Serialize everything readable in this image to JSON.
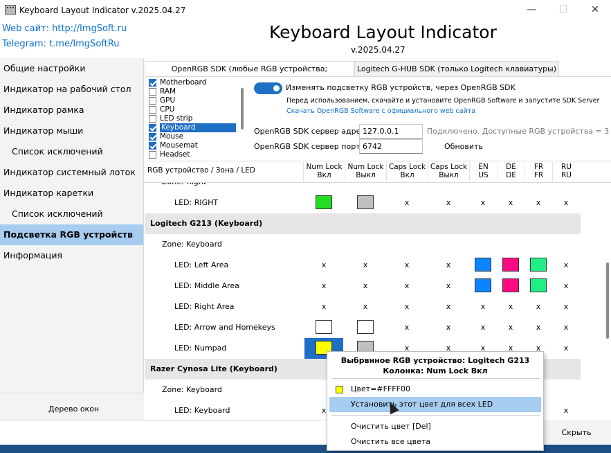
{
  "window": {
    "title": "Keyboard Layout Indicator v.2025.04.27",
    "minimize": "—",
    "maximize": "☐",
    "close": "✕"
  },
  "header": {
    "web_link": "Web сайт: http://ImgSoft.ru",
    "telegram_link": "Telegram: t.me/ImgSoftRu",
    "app_title": "Keyboard Layout Indicator",
    "version": "v.2025.04.27"
  },
  "sidebar": {
    "items": [
      {
        "label": "Общие настройки"
      },
      {
        "label": "Индикатор на рабочий стол"
      },
      {
        "label": "Индикатор рамка"
      },
      {
        "label": "Индикатор мыши"
      },
      {
        "label": "Список исключений"
      },
      {
        "label": "Индикатор системный лоток"
      },
      {
        "label": "Индикатор каретки"
      },
      {
        "label": "Список исключений"
      },
      {
        "label": "Подсветка RGB устройств"
      },
      {
        "label": "Информация"
      }
    ],
    "bottom_label": "Дерево окон"
  },
  "tabs": [
    {
      "label": "OpenRGB SDK (любые RGB устройства; рекомендуется)"
    },
    {
      "label": "Logitech G-HUB SDK (только Logitech клавиатуры)"
    }
  ],
  "devices": [
    {
      "label": "Motherboard",
      "checked": true
    },
    {
      "label": "RAM",
      "checked": false
    },
    {
      "label": "GPU",
      "checked": false
    },
    {
      "label": "CPU",
      "checked": false
    },
    {
      "label": "LED strip",
      "checked": false
    },
    {
      "label": "Keyboard",
      "checked": true
    },
    {
      "label": "Mouse",
      "checked": true
    },
    {
      "label": "Mousemat",
      "checked": true
    },
    {
      "label": "Headset",
      "checked": false
    }
  ],
  "openrgb": {
    "toggle_label": "Изменять подсветку RGB устройств, через OpenRGB SDK",
    "hint": "Перед использованием, скачайте и установите OpenRGB Software и запустите SDK Server",
    "download_link": "Скачать OpenRGB Software с официального web сайта",
    "address_label": "OpenRGB SDK сервер адрес:",
    "address_value": "127.0.0.1",
    "port_label": "OpenRGB SDK сервер порт:",
    "port_value": "6742",
    "status": "Подключено. Доступные RGB устройства = 3",
    "refresh": "Обновить"
  },
  "grid": {
    "first_header": "RGB устройство / Зона / LED",
    "columns": [
      {
        "l1": "Num Lock",
        "l2": "Вкл"
      },
      {
        "l1": "Num Lock",
        "l2": "Выкл"
      },
      {
        "l1": "Caps Lock",
        "l2": "Вкл"
      },
      {
        "l1": "Caps Lock",
        "l2": "Выкл"
      },
      {
        "l1": "EN",
        "l2": "US"
      },
      {
        "l1": "DE",
        "l2": "DE"
      },
      {
        "l1": "FR",
        "l2": "FR"
      },
      {
        "l1": "RU",
        "l2": "RU"
      }
    ],
    "empty_mark": "x",
    "rows": [
      {
        "type": "zone",
        "label": "Zone: Right"
      },
      {
        "type": "led",
        "label": "LED: RIGHT",
        "cells": [
          "#22dd22",
          "#c0c0c0",
          "x",
          "x",
          "x",
          "x",
          "x",
          "x"
        ]
      },
      {
        "type": "group",
        "label": "Logitech G213 (Keyboard)"
      },
      {
        "type": "zone",
        "label": "Zone: Keyboard"
      },
      {
        "type": "led",
        "label": "LED: Left Area",
        "cells": [
          "x",
          "x",
          "x",
          "x",
          "#0a84ff",
          "#ff0a84",
          "#22ee88",
          "x"
        ]
      },
      {
        "type": "led",
        "label": "LED: Middle Area",
        "cells": [
          "x",
          "x",
          "x",
          "x",
          "#0a84ff",
          "#ff0a84",
          "#22ee88",
          "x"
        ]
      },
      {
        "type": "led",
        "label": "LED: Right Area",
        "cells": [
          "x",
          "x",
          "x",
          "x",
          "x",
          "x",
          "x",
          "x"
        ]
      },
      {
        "type": "led",
        "label": "LED: Arrow and Homekeys",
        "cells": [
          "#ffffff",
          "#ffffff",
          "x",
          "x",
          "x",
          "x",
          "x",
          "x"
        ]
      },
      {
        "type": "led",
        "label": "LED: Numpad",
        "cells": [
          "#ffff00",
          "#c0c0c0",
          "x",
          "x",
          "x",
          "x",
          "x",
          "x"
        ]
      },
      {
        "type": "group",
        "label": "Razer Cynosa Lite (Keyboard)"
      },
      {
        "type": "zone",
        "label": "Zone: Keyboard"
      },
      {
        "type": "led",
        "label": "LED: Keyboard",
        "cells": [
          "x",
          "x",
          "x",
          "x",
          "x",
          "x",
          "x",
          "x"
        ]
      }
    ]
  },
  "context_menu": {
    "title_line1": "Выбрвнное RGB устройство: Logitech G213",
    "title_line2": "Колонка: Num Lock Вкл",
    "color_item": "Цвет=#FFFF00",
    "color_value": "#FFFF00",
    "apply_all": "Установить этот цвет для всех LED",
    "clear_color": "Очистить цвет [Del]",
    "clear_all": "Очистить все цвета"
  },
  "footer": {
    "close_button": "Скрыть"
  }
}
